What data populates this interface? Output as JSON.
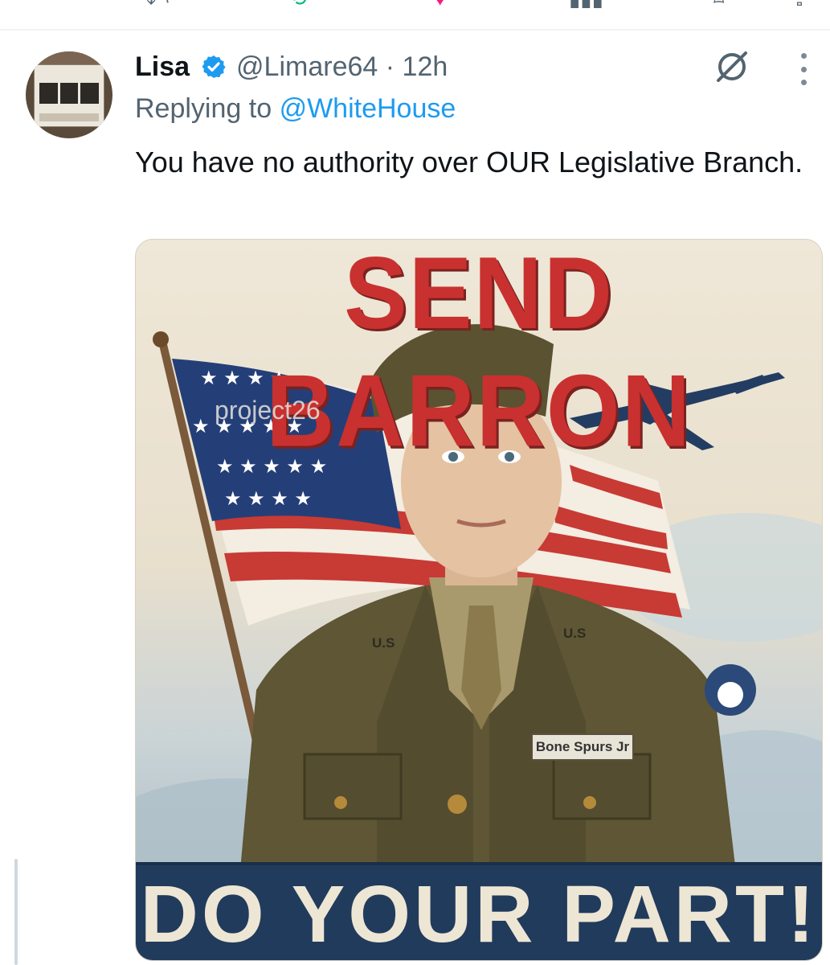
{
  "tweet": {
    "author_name": "Lisa",
    "handle": "@Limare64",
    "separator": "·",
    "time": "12h",
    "replying_prefix": "Replying to",
    "replying_to": "@WhiteHouse",
    "text": "You have no authority over OUR Legislative Branch.",
    "verified": true
  },
  "poster": {
    "title": "SEND BARRON",
    "watermark": "project26",
    "name_tag": "Bone Spurs Jr",
    "collar_left": "U.S",
    "collar_right": "U.S",
    "banner": "DO YOUR PART!"
  },
  "icons": {
    "verified": "verified-badge-icon",
    "grok": "grok-icon",
    "more": "more-dots-icon"
  },
  "colors": {
    "link": "#1d9bf0",
    "verified": "#1d9bf0",
    "title_red": "#c8312f",
    "banner_navy": "#213b5c"
  }
}
